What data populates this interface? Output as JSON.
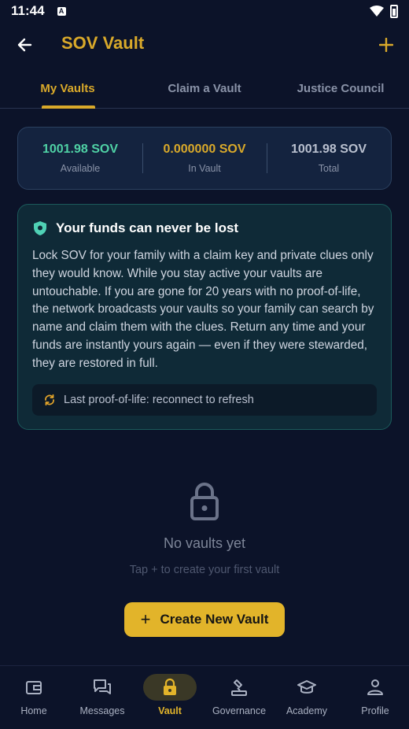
{
  "status_bar": {
    "time": "11:44",
    "notif_glyph": "A"
  },
  "app_bar": {
    "title": "SOV Vault",
    "back_icon": "arrow-left-icon",
    "add_icon": "plus-icon"
  },
  "tabs": [
    {
      "label": "My Vaults",
      "active": true
    },
    {
      "label": "Claim a Vault",
      "active": false
    },
    {
      "label": "Justice Council",
      "active": false
    }
  ],
  "balances": [
    {
      "value": "1001.98 SOV",
      "label": "Available",
      "color": "#4fd1a5"
    },
    {
      "value": "0.000000 SOV",
      "label": "In Vault",
      "color": "#d9a92a"
    },
    {
      "value": "1001.98 SOV",
      "label": "Total",
      "color": "#b9c0cf"
    }
  ],
  "info_card": {
    "title": "Your funds can never be lost",
    "body": "Lock SOV for your family with a claim key and private clues only they would know. While you stay active your vaults are untouchable. If you are gone for 20 years with no proof-of-life, the network broadcasts your vaults so your family can search by name and claim them with the clues. Return any time and your funds are instantly yours again — even if they were stewarded, they are restored in full.",
    "proof_of_life": "Last proof-of-life: reconnect to refresh"
  },
  "empty_state": {
    "title": "No vaults yet",
    "subtitle": "Tap + to create your first vault"
  },
  "create_button": {
    "label": "Create New Vault",
    "glyph": "+"
  },
  "bottom_nav": [
    {
      "label": "Home",
      "icon": "wallet-icon",
      "active": false
    },
    {
      "label": "Messages",
      "icon": "messages-icon",
      "active": false
    },
    {
      "label": "Vault",
      "icon": "lock-icon",
      "active": true
    },
    {
      "label": "Governance",
      "icon": "gavel-icon",
      "active": false
    },
    {
      "label": "Academy",
      "icon": "graduation-cap-icon",
      "active": false
    },
    {
      "label": "Profile",
      "icon": "person-icon",
      "active": false
    }
  ],
  "colors": {
    "accent": "#d9a92a",
    "background": "#0c1329",
    "success": "#4fd1a5"
  }
}
